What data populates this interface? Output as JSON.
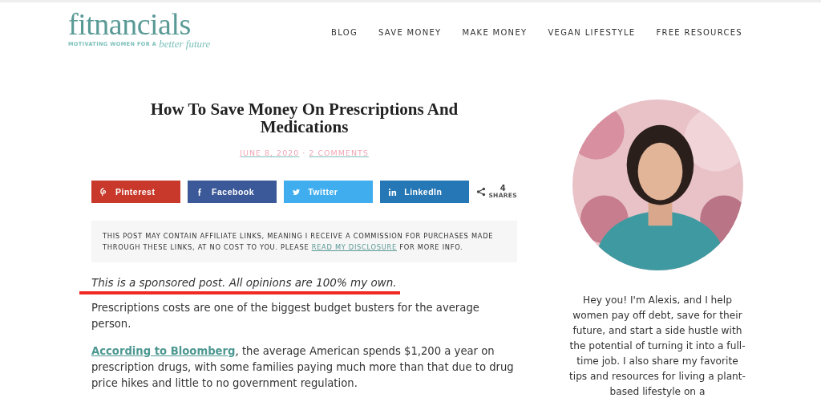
{
  "logo": {
    "name": "fitnancials",
    "tagline": "MOTIVATING WOMEN FOR A",
    "tagline_script": "better future"
  },
  "nav": [
    "BLOG",
    "SAVE MONEY",
    "MAKE MONEY",
    "VEGAN LIFESTYLE",
    "FREE RESOURCES"
  ],
  "post": {
    "title": "How To Save Money On Prescriptions And Medications",
    "date": "JUNE 8, 2020",
    "separator": "·",
    "comments": "2 COMMENTS"
  },
  "share": {
    "buttons": [
      {
        "kind": "pinterest",
        "label": "Pinterest",
        "color": "#c8392b"
      },
      {
        "kind": "facebook",
        "label": "Facebook",
        "color": "#3b5998"
      },
      {
        "kind": "twitter",
        "label": "Twitter",
        "color": "#3fadee"
      },
      {
        "kind": "linkedin",
        "label": "LinkedIn",
        "color": "#2577b5"
      }
    ],
    "count": "4",
    "count_label": "SHARES"
  },
  "disclosure": {
    "before": "THIS POST MAY CONTAIN AFFILIATE LINKS, MEANING I RECEIVE A COMMISSION FOR PURCHASES MADE THROUGH THESE LINKS, AT NO COST TO YOU. PLEASE",
    "link": "READ MY DISCLOSURE",
    "after": "FOR MORE INFO."
  },
  "sponsored": "This is a sponsored post. All opinions are 100% my own.",
  "paragraphs": [
    {
      "text": "Prescriptions costs are one of the biggest budget busters for the average person."
    },
    {
      "link": "According to Bloomberg",
      "text": ", the average American spends $1,200 a year on prescription drugs, with some families paying much more than that due to drug price hikes and little to no government regulation."
    }
  ],
  "sidebar": {
    "bio": "Hey you! I'm Alexis, and I help women pay off debt, save for their future, and start a side hustle with the potential of turning it into a full-time job. I also share my favorite tips and resources for living a plant-based lifestyle on a"
  }
}
